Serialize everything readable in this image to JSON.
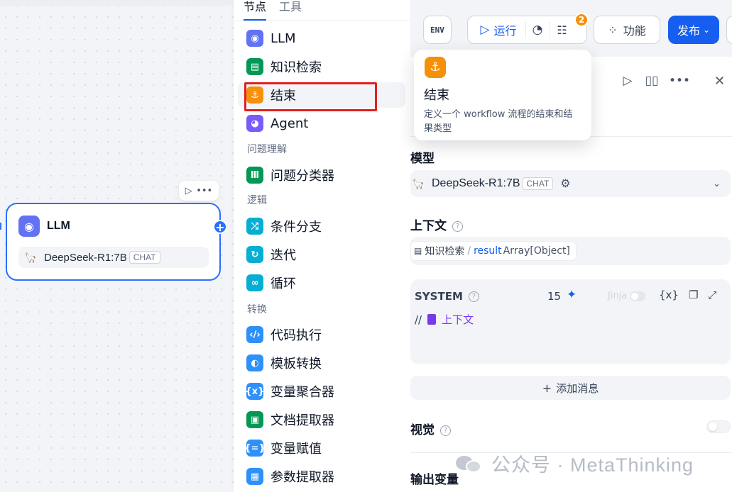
{
  "menu": {
    "tabs": [
      "节点",
      "工具"
    ],
    "items": [
      {
        "label": "LLM",
        "color": "#6172f3",
        "glyph": "◉"
      },
      {
        "label": "知识检索",
        "color": "#039855",
        "glyph": "▤"
      },
      {
        "label": "结束",
        "color": "#f79009",
        "glyph": "⚓"
      },
      {
        "label": "Agent",
        "color": "#7a5af8",
        "glyph": "◕"
      }
    ],
    "groups": {
      "understanding": "问题理解",
      "logic": "逻辑",
      "transform": "转换"
    },
    "understanding_items": [
      {
        "label": "问题分类器",
        "color": "#039855",
        "glyph": "Ⅲ"
      }
    ],
    "logic_items": [
      {
        "label": "条件分支",
        "color": "#06aed4",
        "glyph": "⤮"
      },
      {
        "label": "迭代",
        "color": "#06aed4",
        "glyph": "↻"
      },
      {
        "label": "循环",
        "color": "#06aed4",
        "glyph": "∞"
      }
    ],
    "transform_items": [
      {
        "label": "代码执行",
        "color": "#2e90fa",
        "glyph": "‹/›"
      },
      {
        "label": "模板转换",
        "color": "#2e90fa",
        "glyph": "◐"
      },
      {
        "label": "变量聚合器",
        "color": "#2e90fa",
        "glyph": "{x}"
      },
      {
        "label": "文档提取器",
        "color": "#039855",
        "glyph": "▣"
      },
      {
        "label": "变量赋值",
        "color": "#2e90fa",
        "glyph": "{=}"
      },
      {
        "label": "参数提取器",
        "color": "#2e90fa",
        "glyph": "▦"
      }
    ]
  },
  "node": {
    "title": "LLM",
    "model": "DeepSeek-R1:7B",
    "badge": "CHAT"
  },
  "toolbar": {
    "env": "ENV",
    "run": "运行",
    "badge_count": "2",
    "features": "功能",
    "publish": "发布"
  },
  "tooltip": {
    "title": "结束",
    "description": "定义一个 workflow 流程的结束和结果类型"
  },
  "panel": {
    "model_label": "模型",
    "model_name": "DeepSeek-R1:7B",
    "model_badge": "CHAT",
    "context_label": "上下文",
    "context_source": "知识检索",
    "context_var": "result",
    "context_type": "Array[Object]",
    "system_label": "SYSTEM",
    "system_count": "15",
    "jinja": "Jinja",
    "system_prefix": "//",
    "system_var": "上下文",
    "add_message": "添加消息",
    "vision_label": "视觉",
    "output_label": "输出变量"
  },
  "watermark": "公众号 · MetaThinking"
}
